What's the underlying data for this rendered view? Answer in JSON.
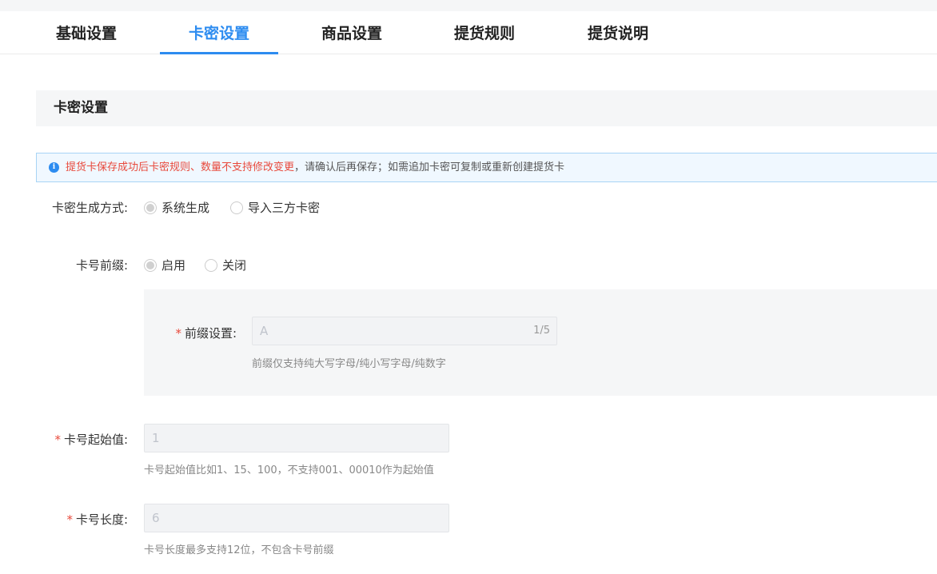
{
  "tabs": [
    {
      "label": "基础设置",
      "active": false
    },
    {
      "label": "卡密设置",
      "active": true
    },
    {
      "label": "商品设置",
      "active": false
    },
    {
      "label": "提货规则",
      "active": false
    },
    {
      "label": "提货说明",
      "active": false
    }
  ],
  "section": {
    "title": "卡密设置"
  },
  "notice": {
    "warning": "提货卡保存成功后卡密规则、数量不支持修改变更",
    "rest": "，请确认后再保存；如需追加卡密可复制或重新创建提货卡"
  },
  "generation": {
    "label": "卡密生成方式:",
    "options": [
      "系统生成",
      "导入三方卡密"
    ],
    "selected": "系统生成"
  },
  "prefix": {
    "label": "卡号前缀:",
    "options": [
      "启用",
      "关闭"
    ],
    "selected": "启用",
    "setting_label": "前缀设置:",
    "value": "A",
    "counter": "1/5",
    "hint": "前缀仅支持纯大写字母/纯小写字母/纯数字"
  },
  "start_value": {
    "label": "卡号起始值:",
    "value": "1",
    "hint": "卡号起始值比如1、15、100，不支持001、00010作为起始值"
  },
  "length": {
    "label": "卡号长度:",
    "value": "6",
    "hint": "卡号长度最多支持12位，不包含卡号前缀"
  },
  "colors": {
    "accent": "#2d8cf0",
    "warning": "#e84a3c"
  }
}
